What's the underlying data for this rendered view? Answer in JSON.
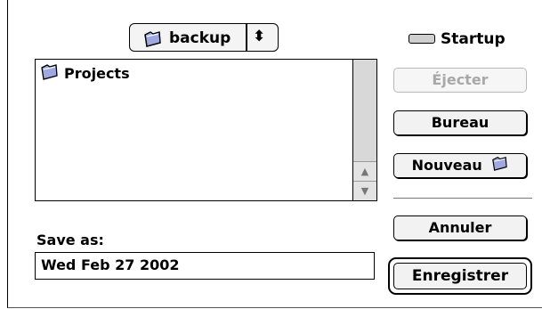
{
  "folder_popup": {
    "label": "backup",
    "arrows": "⬍"
  },
  "disk": {
    "label": "Startup"
  },
  "file_list": {
    "items": [
      {
        "label": "Projects"
      }
    ]
  },
  "buttons": {
    "eject": "Éjecter",
    "desktop": "Bureau",
    "new_folder": "Nouveau",
    "cancel": "Annuler",
    "save": "Enregistrer"
  },
  "save_as": {
    "label": "Save as:",
    "value": "Wed Feb 27 2002"
  }
}
